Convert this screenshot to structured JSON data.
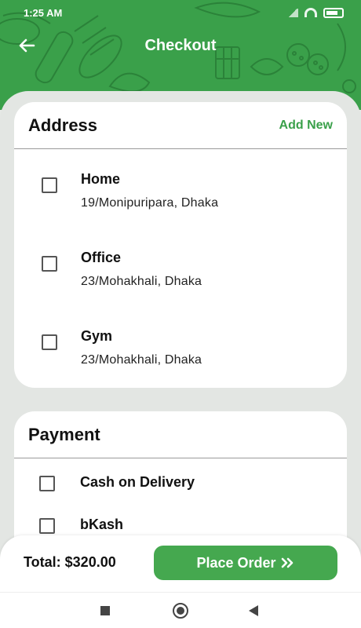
{
  "status_bar": {
    "time": "1:25 AM",
    "icons": [
      "signal-icon",
      "wifi-icon",
      "battery-icon"
    ]
  },
  "app_bar": {
    "title": "Checkout",
    "back_icon": "arrow-left-icon"
  },
  "address": {
    "title": "Address",
    "add_new_label": "Add New",
    "items": [
      {
        "name": "Home",
        "line": "19/Monipuripara, Dhaka",
        "checked": false
      },
      {
        "name": "Office",
        "line": "23/Mohakhali, Dhaka",
        "checked": false
      },
      {
        "name": "Gym",
        "line": "23/Mohakhali, Dhaka",
        "checked": false
      }
    ]
  },
  "payment": {
    "title": "Payment",
    "options": [
      {
        "label": "Cash on Delivery",
        "checked": false
      },
      {
        "label": "bKash",
        "checked": false
      }
    ]
  },
  "footer": {
    "total_label": "Total: $320.00",
    "place_order_label": "Place Order",
    "place_order_icon": "double-chevron-right-icon"
  },
  "nav_bar": {
    "icons": [
      "recents-square-icon",
      "home-circle-icon",
      "back-triangle-icon"
    ]
  },
  "colors": {
    "accent": "#3aa04a",
    "button": "#45a84f",
    "background": "#e3e6e3"
  }
}
